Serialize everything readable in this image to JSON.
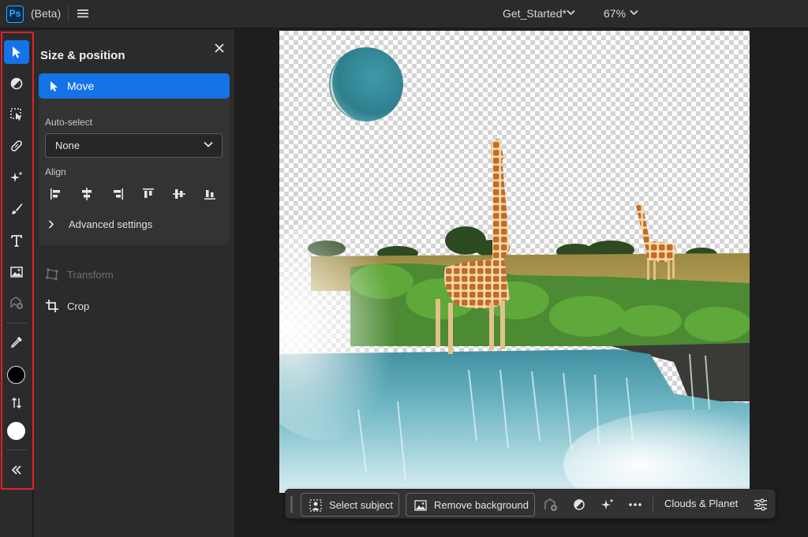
{
  "app": {
    "logo": "Ps",
    "beta_label": "(Beta)",
    "document_name": "Get_Started*",
    "zoom_level": "67%",
    "accent_color": "#1473e6"
  },
  "toolbar": {
    "tools": [
      {
        "icon": "move-arrow-icon",
        "active": true
      },
      {
        "icon": "adjustment-icon"
      },
      {
        "icon": "selection-icon"
      },
      {
        "icon": "healing-bandage-icon"
      },
      {
        "icon": "generative-fill-icon"
      },
      {
        "icon": "brush-icon"
      },
      {
        "icon": "type-icon"
      },
      {
        "icon": "place-image-icon"
      },
      {
        "icon": "add-image-icon"
      },
      {
        "icon": "eyedropper-icon"
      },
      {
        "icon": "foreground-color-swatch",
        "color": "#000000"
      },
      {
        "icon": "swap-colors-icon"
      },
      {
        "icon": "background-color-swatch",
        "color": "#ffffff"
      },
      {
        "icon": "collapse-icon"
      }
    ]
  },
  "panel": {
    "title": "Size & position",
    "move_label": "Move",
    "auto_select_label": "Auto-select",
    "auto_select_value": "None",
    "align_label": "Align",
    "align_buttons": [
      "align-left-icon",
      "align-horizontal-center-icon",
      "align-right-icon",
      "align-top-icon",
      "align-vertical-center-icon",
      "align-bottom-icon"
    ],
    "advanced_settings_label": "Advanced settings",
    "transform_label": "Transform",
    "crop_label": "Crop"
  },
  "context_bar": {
    "select_subject_label": "Select subject",
    "remove_background_label": "Remove background",
    "layer_name": "Clouds & Planet"
  }
}
